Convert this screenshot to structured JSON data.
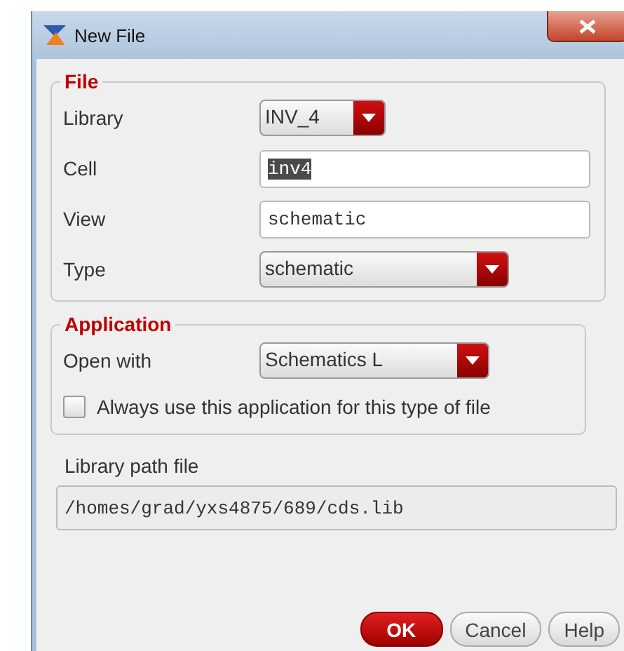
{
  "window": {
    "title": "New File"
  },
  "file_group": {
    "title": "File",
    "rows": [
      {
        "kind": "combo",
        "label": "Library",
        "value": "INV_4"
      },
      {
        "kind": "field",
        "label": "Cell",
        "value": "inv4",
        "highlighted": true
      },
      {
        "kind": "field",
        "label": "View",
        "value": "schematic",
        "highlighted": false
      },
      {
        "kind": "combo",
        "label": "Type",
        "value": "schematic"
      }
    ]
  },
  "application_group": {
    "title": "Application",
    "open_with": {
      "label": "Open with",
      "value": "Schematics L"
    },
    "always_use": {
      "label": "Always use this application for this type of file",
      "checked": false
    }
  },
  "library_path": {
    "label": "Library path file",
    "value": "/homes/grad/yxs4875/689/cds.lib",
    "readonly": true
  },
  "buttons": [
    {
      "label": "OK",
      "kind": "default"
    },
    {
      "label": "Cancel",
      "kind": "normal"
    },
    {
      "label": "Help",
      "kind": "normal"
    }
  ]
}
